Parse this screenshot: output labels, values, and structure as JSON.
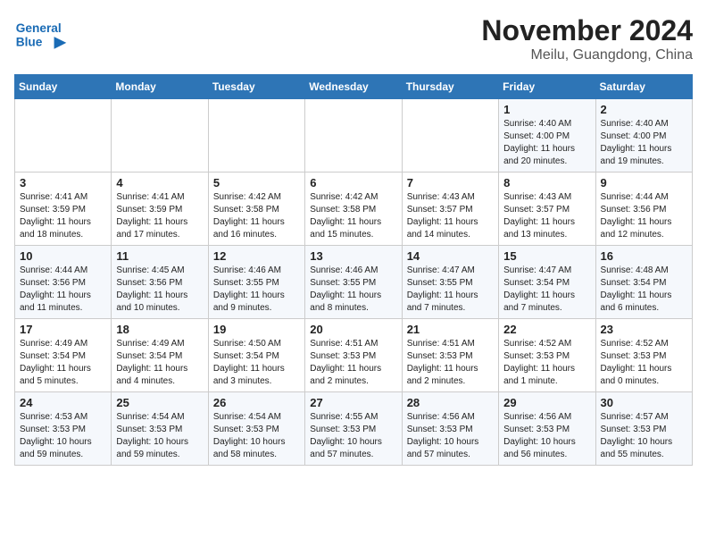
{
  "header": {
    "logo_line1": "General",
    "logo_line2": "Blue",
    "title": "November 2024",
    "subtitle": "Meilu, Guangdong, China"
  },
  "weekdays": [
    "Sunday",
    "Monday",
    "Tuesday",
    "Wednesday",
    "Thursday",
    "Friday",
    "Saturday"
  ],
  "weeks": [
    [
      {
        "day": "",
        "info": ""
      },
      {
        "day": "",
        "info": ""
      },
      {
        "day": "",
        "info": ""
      },
      {
        "day": "",
        "info": ""
      },
      {
        "day": "",
        "info": ""
      },
      {
        "day": "1",
        "info": "Sunrise: 4:40 AM\nSunset: 4:00 PM\nDaylight: 11 hours\nand 20 minutes."
      },
      {
        "day": "2",
        "info": "Sunrise: 4:40 AM\nSunset: 4:00 PM\nDaylight: 11 hours\nand 19 minutes."
      }
    ],
    [
      {
        "day": "3",
        "info": "Sunrise: 4:41 AM\nSunset: 3:59 PM\nDaylight: 11 hours\nand 18 minutes."
      },
      {
        "day": "4",
        "info": "Sunrise: 4:41 AM\nSunset: 3:59 PM\nDaylight: 11 hours\nand 17 minutes."
      },
      {
        "day": "5",
        "info": "Sunrise: 4:42 AM\nSunset: 3:58 PM\nDaylight: 11 hours\nand 16 minutes."
      },
      {
        "day": "6",
        "info": "Sunrise: 4:42 AM\nSunset: 3:58 PM\nDaylight: 11 hours\nand 15 minutes."
      },
      {
        "day": "7",
        "info": "Sunrise: 4:43 AM\nSunset: 3:57 PM\nDaylight: 11 hours\nand 14 minutes."
      },
      {
        "day": "8",
        "info": "Sunrise: 4:43 AM\nSunset: 3:57 PM\nDaylight: 11 hours\nand 13 minutes."
      },
      {
        "day": "9",
        "info": "Sunrise: 4:44 AM\nSunset: 3:56 PM\nDaylight: 11 hours\nand 12 minutes."
      }
    ],
    [
      {
        "day": "10",
        "info": "Sunrise: 4:44 AM\nSunset: 3:56 PM\nDaylight: 11 hours\nand 11 minutes."
      },
      {
        "day": "11",
        "info": "Sunrise: 4:45 AM\nSunset: 3:56 PM\nDaylight: 11 hours\nand 10 minutes."
      },
      {
        "day": "12",
        "info": "Sunrise: 4:46 AM\nSunset: 3:55 PM\nDaylight: 11 hours\nand 9 minutes."
      },
      {
        "day": "13",
        "info": "Sunrise: 4:46 AM\nSunset: 3:55 PM\nDaylight: 11 hours\nand 8 minutes."
      },
      {
        "day": "14",
        "info": "Sunrise: 4:47 AM\nSunset: 3:55 PM\nDaylight: 11 hours\nand 7 minutes."
      },
      {
        "day": "15",
        "info": "Sunrise: 4:47 AM\nSunset: 3:54 PM\nDaylight: 11 hours\nand 7 minutes."
      },
      {
        "day": "16",
        "info": "Sunrise: 4:48 AM\nSunset: 3:54 PM\nDaylight: 11 hours\nand 6 minutes."
      }
    ],
    [
      {
        "day": "17",
        "info": "Sunrise: 4:49 AM\nSunset: 3:54 PM\nDaylight: 11 hours\nand 5 minutes."
      },
      {
        "day": "18",
        "info": "Sunrise: 4:49 AM\nSunset: 3:54 PM\nDaylight: 11 hours\nand 4 minutes."
      },
      {
        "day": "19",
        "info": "Sunrise: 4:50 AM\nSunset: 3:54 PM\nDaylight: 11 hours\nand 3 minutes."
      },
      {
        "day": "20",
        "info": "Sunrise: 4:51 AM\nSunset: 3:53 PM\nDaylight: 11 hours\nand 2 minutes."
      },
      {
        "day": "21",
        "info": "Sunrise: 4:51 AM\nSunset: 3:53 PM\nDaylight: 11 hours\nand 2 minutes."
      },
      {
        "day": "22",
        "info": "Sunrise: 4:52 AM\nSunset: 3:53 PM\nDaylight: 11 hours\nand 1 minute."
      },
      {
        "day": "23",
        "info": "Sunrise: 4:52 AM\nSunset: 3:53 PM\nDaylight: 11 hours\nand 0 minutes."
      }
    ],
    [
      {
        "day": "24",
        "info": "Sunrise: 4:53 AM\nSunset: 3:53 PM\nDaylight: 10 hours\nand 59 minutes."
      },
      {
        "day": "25",
        "info": "Sunrise: 4:54 AM\nSunset: 3:53 PM\nDaylight: 10 hours\nand 59 minutes."
      },
      {
        "day": "26",
        "info": "Sunrise: 4:54 AM\nSunset: 3:53 PM\nDaylight: 10 hours\nand 58 minutes."
      },
      {
        "day": "27",
        "info": "Sunrise: 4:55 AM\nSunset: 3:53 PM\nDaylight: 10 hours\nand 57 minutes."
      },
      {
        "day": "28",
        "info": "Sunrise: 4:56 AM\nSunset: 3:53 PM\nDaylight: 10 hours\nand 57 minutes."
      },
      {
        "day": "29",
        "info": "Sunrise: 4:56 AM\nSunset: 3:53 PM\nDaylight: 10 hours\nand 56 minutes."
      },
      {
        "day": "30",
        "info": "Sunrise: 4:57 AM\nSunset: 3:53 PM\nDaylight: 10 hours\nand 55 minutes."
      }
    ]
  ]
}
